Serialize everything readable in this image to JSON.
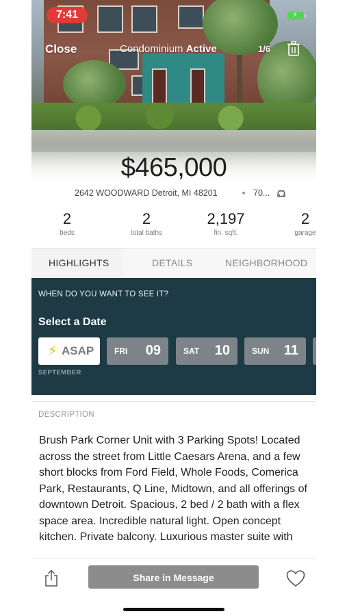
{
  "status": {
    "time": "7:41"
  },
  "header": {
    "close_label": "Close",
    "property_type": "Condominium",
    "status": "Active",
    "photo_counter": "1/6"
  },
  "listing": {
    "price": "$465,000",
    "address": "2642 WOODWARD Detroit, MI 48201",
    "commute": "70...",
    "stats": [
      {
        "value": "2",
        "label": "beds"
      },
      {
        "value": "2",
        "label": "total baths"
      },
      {
        "value": "2,197",
        "label": "fin. sqft."
      },
      {
        "value": "2",
        "label": "garage"
      }
    ]
  },
  "tabs": [
    {
      "label": "HIGHLIGHTS",
      "active": true
    },
    {
      "label": "DETAILS",
      "active": false
    },
    {
      "label": "NEIGHBORHOOD",
      "active": false
    }
  ],
  "scheduler": {
    "question": "WHEN DO YOU WANT TO SEE IT?",
    "heading": "Select a Date",
    "asap_label": "ASAP",
    "dates": [
      {
        "dow": "FRI",
        "day": "09"
      },
      {
        "dow": "SAT",
        "day": "10"
      },
      {
        "dow": "SUN",
        "day": "11"
      }
    ],
    "month": "SEPTEMBER"
  },
  "description": {
    "heading": "DESCRIPTION",
    "text": "Brush Park Corner Unit with 3 Parking Spots! Located across the street from Little Caesars Arena, and a few short blocks from Ford Field, Whole Foods, Comerica Park, Restaurants, Q Line, Midtown, and all offerings of downtown Detroit. Spacious, 2 bed / 2 bath with a flex space area. Incredible natural light. Open concept kitchen. Private balcony. Luxurious master suite with"
  },
  "actions": {
    "share_label": "Share in Message"
  },
  "colors": {
    "scheduler_bg": "#1d3a45",
    "date_chip": "#7d8489",
    "status_red": "#e23a36",
    "share_button": "#8c8c8c",
    "bolt": "#f2b705"
  },
  "icons": [
    "trash-icon",
    "car-icon",
    "lightning-icon",
    "share-icon",
    "heart-icon",
    "battery-icon"
  ]
}
